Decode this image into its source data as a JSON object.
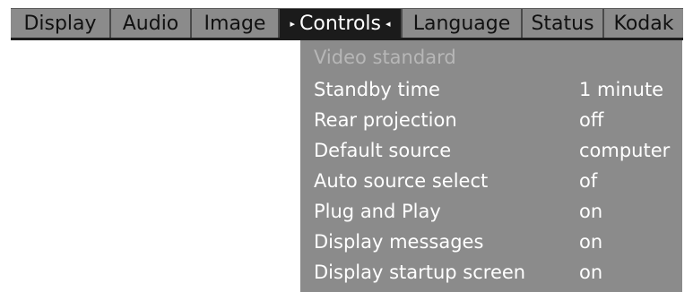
{
  "menu": {
    "tabs": [
      {
        "label": "Display"
      },
      {
        "label": "Audio"
      },
      {
        "label": "Image"
      },
      {
        "label": "Controls",
        "left_marker": "▸",
        "right_marker": "◂"
      },
      {
        "label": "Language"
      },
      {
        "label": "Status"
      },
      {
        "label": "Kodak"
      }
    ],
    "selected_tab": "Controls"
  },
  "controls_menu": {
    "items": [
      {
        "label": "Video standard",
        "value": "",
        "enabled": false
      },
      {
        "label": "Standby time",
        "value": "1 minute",
        "enabled": true
      },
      {
        "label": "Rear projection",
        "value": "off",
        "enabled": true
      },
      {
        "label": "Default source",
        "value": "computer",
        "enabled": true
      },
      {
        "label": "Auto source select",
        "value": "of",
        "enabled": true
      },
      {
        "label": "Plug and Play",
        "value": "on",
        "enabled": true
      },
      {
        "label": "Display messages",
        "value": "on",
        "enabled": true
      },
      {
        "label": "Display startup screen",
        "value": "on",
        "enabled": true
      }
    ]
  },
  "colors": {
    "menu_background": "#8b8b8b",
    "selected_tab_background": "#1b1b1b",
    "text_enabled": "#ffffff",
    "text_disabled": "#b7b7b7",
    "tab_text": "#111111"
  }
}
